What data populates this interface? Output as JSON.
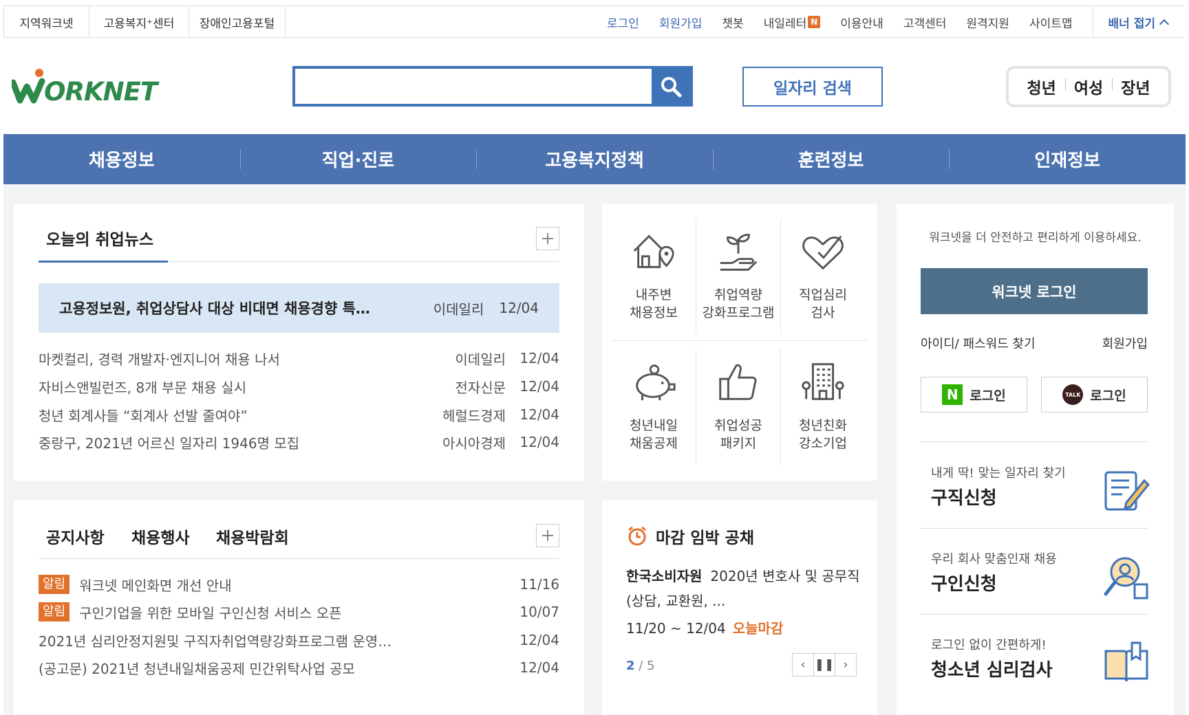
{
  "util_left": [
    "지역워크넷",
    "고용복지⁺센터",
    "장애인고용포털"
  ],
  "util_right": {
    "login": "로그인",
    "signup": "회원가입",
    "chatbot": "챗봇",
    "newsletter": "내일레터",
    "newsletter_badge": "N",
    "guide": "이용안내",
    "customer": "고객센터",
    "remote": "원격지원",
    "sitemap": "사이트맵",
    "banner_toggle": "배너 접기"
  },
  "header": {
    "logo_text": "ORKNET",
    "search_placeholder": "",
    "job_search_button": "일자리 검색",
    "audience": [
      "청년",
      "여성",
      "장년"
    ]
  },
  "gnb": [
    "채용정보",
    "직업·진로",
    "고용복지정책",
    "훈련정보",
    "인재정보"
  ],
  "news": {
    "title": "오늘의 취업뉴스",
    "headline": {
      "title": "고용정보원, 취업상담사 대상 비대면 채용경향 특…",
      "source": "이데일리",
      "date": "12/04"
    },
    "items": [
      {
        "title": "마켓컬리, 경력 개발자·엔지니어 채용 나서",
        "source": "이데일리",
        "date": "12/04"
      },
      {
        "title": "자비스앤빌런즈, 8개 부문 채용 실시",
        "source": "전자신문",
        "date": "12/04"
      },
      {
        "title": "청년 회계사들 “회계사 선발 줄여야”",
        "source": "헤럴드경제",
        "date": "12/04"
      },
      {
        "title": "중랑구, 2021년 어르신 일자리 1946명 모집",
        "source": "아시아경제",
        "date": "12/04"
      }
    ]
  },
  "services": [
    {
      "label": "내주변\n채용정보",
      "icon": "house-location-icon"
    },
    {
      "label": "취업역량\n강화프로그램",
      "icon": "hand-sprout-icon"
    },
    {
      "label": "직업심리\n검사",
      "icon": "heart-check-icon"
    },
    {
      "label": "청년내일\n채움공제",
      "icon": "piggy-bank-icon"
    },
    {
      "label": "취업성공\n패키지",
      "icon": "thumbs-up-icon"
    },
    {
      "label": "청년친화\n강소기업",
      "icon": "building-icon"
    }
  ],
  "login_panel": {
    "notice": "워크넷을 더 안전하고 편리하게 이용하세요.",
    "login_button": "워크넷 로그인",
    "find": "아이디/ 패스워드 찾기",
    "join": "회원가입",
    "naver_login": "로그인",
    "kakao_login": "로그인",
    "kakao_badge": "TALK",
    "naver_badge": "N",
    "quick": [
      {
        "sub": "내게 딱! 맞는 일자리 찾기",
        "main": "구직신청"
      },
      {
        "sub": "우리 회사 맞춤인재 채용",
        "main": "구인신청"
      },
      {
        "sub": "로그인 없이 간편하게!",
        "main": "청소년 심리검사"
      }
    ]
  },
  "notice": {
    "tabs": [
      "공지사항",
      "채용행사",
      "채용박람회"
    ],
    "items": [
      {
        "tag": "알림",
        "title": "워크넷 메인화면 개선 안내",
        "date": "11/16"
      },
      {
        "tag": "알림",
        "title": "구인기업을 위한 모바일 구인신청 서비스 오픈",
        "date": "10/07"
      },
      {
        "tag": "",
        "title": "2021년 심리안정지원및 구직자취업역량강화프로그램 운영…",
        "date": "12/04"
      },
      {
        "tag": "",
        "title": "(공고문) 2021년 청년내일채움공제 민간위탁사업 공모",
        "date": "12/04"
      }
    ]
  },
  "deadline": {
    "title": "마감 임박 공채",
    "company": "한국소비자원",
    "description": "2020년 변호사 및 공무직(상담, 교환원, ...",
    "period": "11/20 ~ 12/04",
    "today": "오늘마감",
    "page_current": "2",
    "page_total": "/ 5"
  },
  "colors": {
    "primary": "#4c72b0",
    "accent": "#e2712b",
    "login": "#4e6f89",
    "highlight": "#d9e6f5"
  }
}
